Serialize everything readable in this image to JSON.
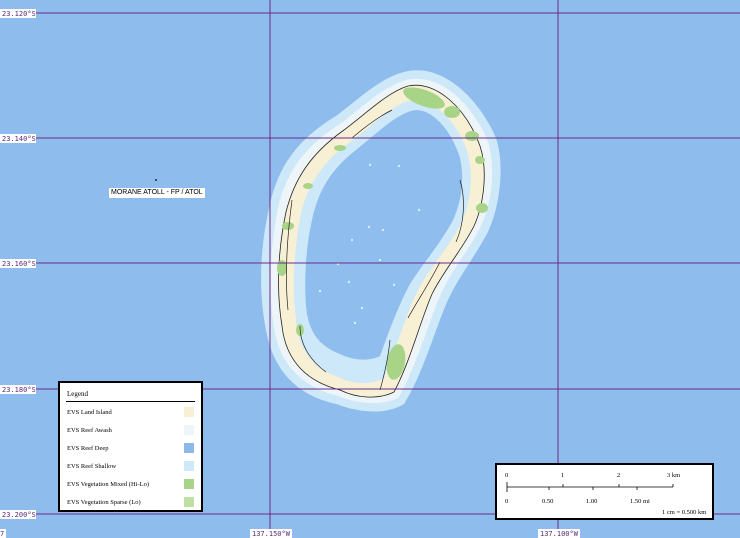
{
  "map": {
    "latitudes": [
      "23.120°S",
      "23.140°S",
      "23.160°S",
      "23.180°S",
      "23.200°S"
    ],
    "longitudes": [
      "137.150°W",
      "137.100°W"
    ],
    "edge_fragment": "7",
    "place_label": "MORANE ATOLL - FP / ATOL"
  },
  "legend": {
    "title": "Legend",
    "items": [
      {
        "label": "EVS Land Island",
        "color": "#f8f0d4"
      },
      {
        "label": "EVS Reef Awash",
        "color": "#eef5f8"
      },
      {
        "label": "EVS Reef Deep",
        "color": "#8cb8ea"
      },
      {
        "label": "EVS Reef Shallow",
        "color": "#cde8f8"
      },
      {
        "label": "EVS Vegetation Mixed (Hi-Lo)",
        "color": "#a8d488"
      },
      {
        "label": "EVS Vegetation Sparse (Lo)",
        "color": "#bfe0a0"
      }
    ]
  },
  "scale_bar": {
    "km_ticks": [
      "0",
      "1",
      "2",
      "3 km"
    ],
    "mi_ticks": [
      "0",
      "0.50",
      "1.00",
      "1.50 mi"
    ],
    "ratio": "1 cm = 0.500 km"
  },
  "colors": {
    "ocean": "#8ebcec",
    "lagoon": "#8fbdee",
    "reef_shallow": "#cde8f8",
    "reef_awash": "#eef5f8",
    "land": "#f8f0d4",
    "vegetation": "#a8d488",
    "grid": "#6a2a8a"
  }
}
